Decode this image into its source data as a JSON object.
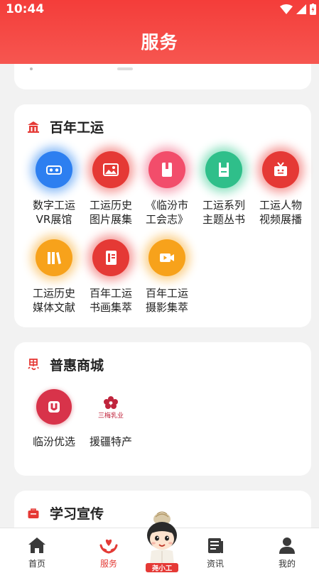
{
  "status_bar": {
    "time": "10:44"
  },
  "header": {
    "title": "服务"
  },
  "sections": {
    "heritage": {
      "title": "百年工运",
      "items": [
        {
          "line1": "数字工运",
          "line2": "VR展馆",
          "icon": "vr-headset-icon",
          "color": "#2d7ff0",
          "glow": "#8bbcf7"
        },
        {
          "line1": "工运历史",
          "line2": "图片展集",
          "icon": "image-icon",
          "color": "#e53935",
          "glow": "#f59a98"
        },
        {
          "line1": "《临汾市",
          "line2": "工会志》",
          "icon": "book-icon",
          "color": "#f24d6b",
          "glow": "#f7a7b8"
        },
        {
          "line1": "工运系列",
          "line2": "主题丛书",
          "icon": "save-book-icon",
          "color": "#2fbf8a",
          "glow": "#8fe2c2"
        },
        {
          "line1": "工运人物",
          "line2": "视频展播",
          "icon": "tv-icon",
          "color": "#e53935",
          "glow": "#f59a98"
        },
        {
          "line1": "工运历史",
          "line2": "媒体文献",
          "icon": "library-icon",
          "color": "#f7a21b",
          "glow": "#fbd08a"
        },
        {
          "line1": "百年工运",
          "line2": "书画集萃",
          "icon": "notebook-icon",
          "color": "#e53935",
          "glow": "#f59a98"
        },
        {
          "line1": "百年工运",
          "line2": "摄影集萃",
          "icon": "video-camera-icon",
          "color": "#f7a21b",
          "glow": "#fbd08a"
        }
      ]
    },
    "mall": {
      "title": "普惠商城",
      "items": [
        {
          "label": "临汾优选",
          "icon": "u-logo-icon",
          "color": "#d8334a"
        },
        {
          "label": "援疆特产",
          "icon": "sanmei-logo",
          "logo_text": "三梅乳业",
          "color": "#c0243c"
        }
      ]
    },
    "study": {
      "title": "学习宣传"
    }
  },
  "bottom_nav": {
    "items": [
      {
        "label": "首页",
        "icon": "home-icon"
      },
      {
        "label": "服务",
        "icon": "service-heart-icon",
        "active": true
      },
      {
        "label": "",
        "icon": "mascot-avatar",
        "badge": "尧小工"
      },
      {
        "label": "资讯",
        "icon": "news-icon"
      },
      {
        "label": "我的",
        "icon": "user-icon"
      }
    ]
  },
  "colors": {
    "primary": "#f43d3a",
    "background": "#f2f2f2",
    "card": "#ffffff"
  }
}
